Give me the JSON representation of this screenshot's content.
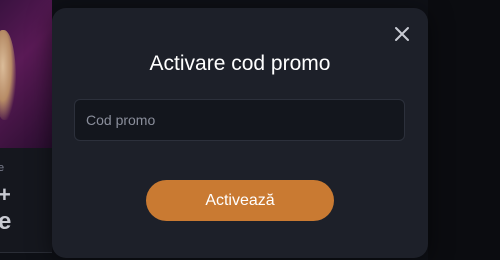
{
  "background": {
    "label_small": "e",
    "label_plus": "+",
    "label_big": "e"
  },
  "modal": {
    "title": "Activare cod promo",
    "close_icon": "close-icon",
    "promo_input": {
      "value": "",
      "placeholder": "Cod promo"
    },
    "submit_label": "Activează"
  },
  "colors": {
    "modal_bg": "#1d2029",
    "accent": "#c97a32",
    "input_bg": "#13161d",
    "input_border": "#2c303b"
  }
}
